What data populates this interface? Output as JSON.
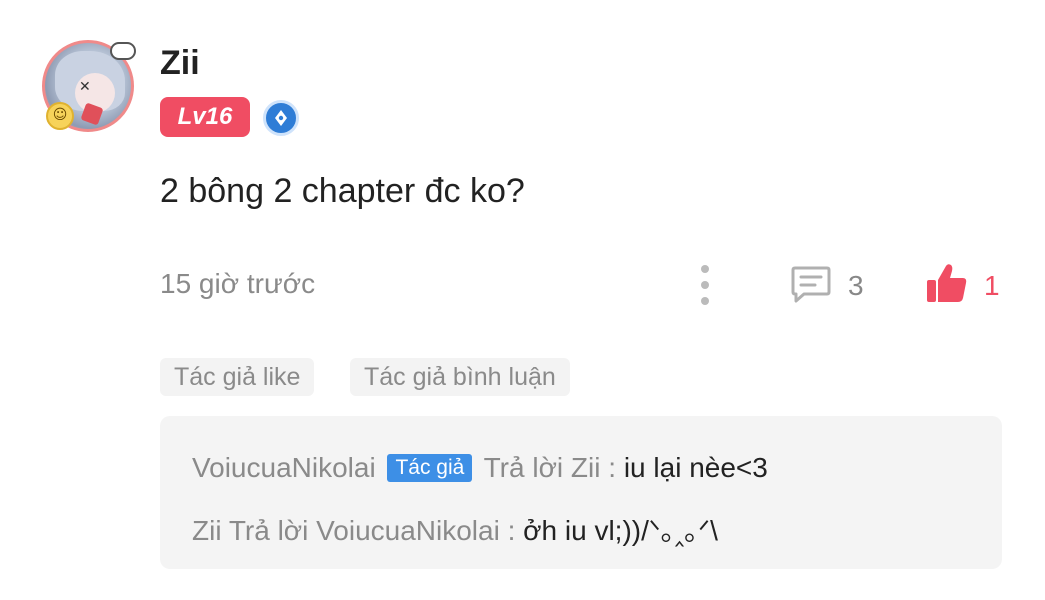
{
  "user": {
    "name": "Zii",
    "level": "Lv16"
  },
  "comment": {
    "text": "2 bông 2 chapter đc ko?",
    "time": "15 giờ trước",
    "reply_count": "3",
    "like_count": "1"
  },
  "tags": [
    "Tác giả like",
    "Tác giả bình luận"
  ],
  "replies": [
    {
      "from": "VoiucuaNikolai",
      "badge": "Tác giả",
      "action": "Trả lời Zii :",
      "text": "iu lại nèe<3"
    },
    {
      "from": "Zii",
      "action": "Trả lời VoiucuaNikolai :",
      "text": "ởh iu vl;))/ᐠ｡‸｡ᐟ\\"
    }
  ],
  "colors": {
    "accent": "#f04d63",
    "author_badge": "#3d8fe6",
    "muted_text": "#8a8a8a",
    "panel_bg": "#f4f4f4"
  },
  "icons": [
    "avatar",
    "cloud-icon",
    "smile-badge-icon",
    "verified-pen-icon",
    "more-vertical-icon",
    "comment-icon",
    "thumbs-up-icon"
  ]
}
